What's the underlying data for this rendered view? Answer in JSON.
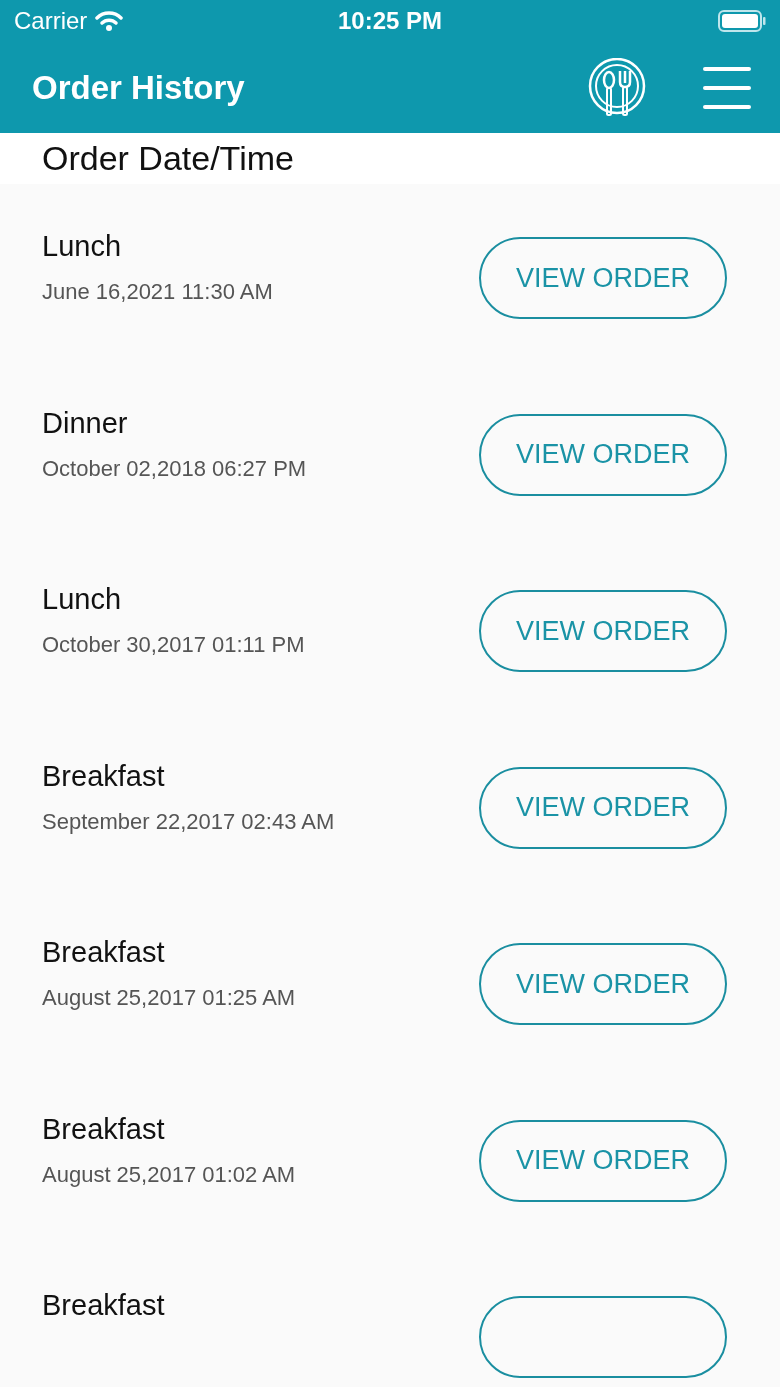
{
  "status_bar": {
    "carrier": "Carrier",
    "time": "10:25 PM"
  },
  "nav_bar": {
    "title": "Order History"
  },
  "section_header": "Order Date/Time",
  "orders": [
    {
      "meal": "Lunch",
      "datetime": "June 16,2021 11:30 AM",
      "button": "VIEW ORDER"
    },
    {
      "meal": "Dinner",
      "datetime": "October 02,2018 06:27 PM",
      "button": "VIEW ORDER"
    },
    {
      "meal": "Lunch",
      "datetime": "October 30,2017 01:11 PM",
      "button": "VIEW ORDER"
    },
    {
      "meal": "Breakfast",
      "datetime": "September 22,2017 02:43 AM",
      "button": "VIEW ORDER"
    },
    {
      "meal": "Breakfast",
      "datetime": "August 25,2017 01:25 AM",
      "button": "VIEW ORDER"
    },
    {
      "meal": "Breakfast",
      "datetime": "August 25,2017 01:02 AM",
      "button": "VIEW ORDER"
    },
    {
      "meal": "Breakfast"
    }
  ]
}
